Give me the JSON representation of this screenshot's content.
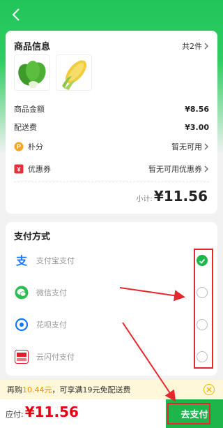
{
  "nav": {
    "back_icon": "chevron-left-icon"
  },
  "goods": {
    "title": "商品信息",
    "count": "共2件",
    "items": [
      {
        "icon": "bok-choy-image"
      },
      {
        "icon": "corn-image"
      }
    ],
    "amount_label": "商品金额",
    "amount_value": "¥8.56",
    "delivery_label": "配送费",
    "delivery_value": "¥3.00",
    "points_label": "朴分",
    "points_value": "暂无可用",
    "coupon_label": "优惠券",
    "coupon_value": "暂无可用优惠券",
    "subtotal_label": "小计:",
    "subtotal_value": "¥11.56"
  },
  "payment": {
    "title": "支付方式",
    "methods": [
      {
        "label": "支付宝支付",
        "icon": "alipay-icon",
        "selected": true
      },
      {
        "label": "微信支付",
        "icon": "wechat-icon",
        "selected": false
      },
      {
        "label": "花呗支付",
        "icon": "huabei-icon",
        "selected": false
      },
      {
        "label": "云闪付支付",
        "icon": "unionpay-icon",
        "selected": false
      }
    ]
  },
  "promo": {
    "prefix": "再购",
    "amount": "10.44元",
    "suffix": "，可享满19元免配送费"
  },
  "footer": {
    "total_label": "应付:",
    "total_value": "¥11.56",
    "pay_button": "去支付"
  },
  "colors": {
    "brand_green": "#1db64b",
    "price_red": "#e60012",
    "highlight_red": "#e8272c"
  }
}
